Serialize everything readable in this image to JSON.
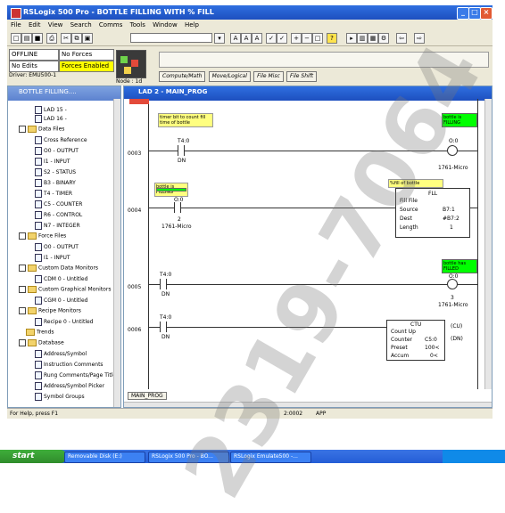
{
  "window": {
    "title": "RSLogix 500 Pro - BOTTLE FILLING WITH % FILL"
  },
  "menu": [
    "File",
    "Edit",
    "View",
    "Search",
    "Comms",
    "Tools",
    "Window",
    "Help"
  ],
  "status": {
    "mode": "OFFLINE",
    "forces": "No Forces",
    "edits": "No Edits",
    "forces_enabled": "Forces Enabled",
    "driver": "Driver: EMU500-1",
    "node": "Node : 1d"
  },
  "instruction_tabs": [
    "Compute/Math",
    "Move/Logical",
    "File Misc",
    "File Shift"
  ],
  "left_panel": {
    "title": "BOTTLE FILLING....",
    "items": [
      "LAD 15 -",
      "LAD 16 -",
      "Data Files",
      "Cross Reference",
      "O0 - OUTPUT",
      "I1 - INPUT",
      "S2 - STATUS",
      "B3 - BINARY",
      "T4 - TIMER",
      "C5 - COUNTER",
      "R6 - CONTROL",
      "N7 - INTEGER",
      "Force Files",
      "O0 - OUTPUT",
      "I1 - INPUT",
      "Custom Data Monitors",
      "CDM 0 - Untitled",
      "Custom Graphical Monitors",
      "CGM 0 - Untitled",
      "Recipe Monitors",
      "Recipe 0 - Untitled",
      "Trends",
      "Database",
      "Address/Symbol",
      "Instruction Comments",
      "Rung Comments/Page Title",
      "Address/Symbol Picker",
      "Symbol Groups"
    ]
  },
  "ladder": {
    "title": "LAD 2 - MAIN_PROG",
    "rungs": [
      {
        "number": "0003",
        "note": "timer bit to count fill time of bottle",
        "contact_addr": "T4:0",
        "contact_bit": "DN",
        "coil_note": "bottle is FILLING",
        "coil_addr": "O:0",
        "coil_sub": "1761-Micro"
      },
      {
        "number": "0004",
        "note": "bottle is FILLING",
        "contact_addr": "O:0",
        "contact_sub": "2",
        "contact_sub2": "1761-Micro",
        "box_note": "%fill of bottle",
        "box_title": "FLL",
        "box_name": "Fill File",
        "box_rows": [
          {
            "label": "Source",
            "value": "B7:1"
          },
          {
            "label": "Dest",
            "value": "#B7:2"
          },
          {
            "label": "Length",
            "value": "1"
          }
        ]
      },
      {
        "number": "0005",
        "contact_addr": "T4:0",
        "contact_bit": "DN",
        "coil_note": "bottle has FILLED",
        "coil_addr": "O:0",
        "coil_sub": "3",
        "coil_sub2": "1761-Micro"
      },
      {
        "number": "0006",
        "contact_addr": "T4:0",
        "contact_bit": "DN",
        "box_title": "CTU",
        "box_name": "Count Up",
        "box_rows": [
          {
            "label": "Counter",
            "value": "C5:0"
          },
          {
            "label": "Preset",
            "value": "100<"
          },
          {
            "label": "Accum",
            "value": "0<"
          }
        ],
        "cu": "(CU)",
        "dn": "(DN)"
      }
    ],
    "bottom_tab": "MAIN_PROG"
  },
  "statusbar": {
    "help": "For Help, press F1",
    "pos": "2:0002",
    "mode": "APP"
  },
  "taskbar": {
    "start": "start",
    "items": [
      "Removable Disk (E:)",
      "RSLogix 500 Pro - BO...",
      "RSLogix Emulate500 -..."
    ]
  },
  "watermark": "2319-7064"
}
